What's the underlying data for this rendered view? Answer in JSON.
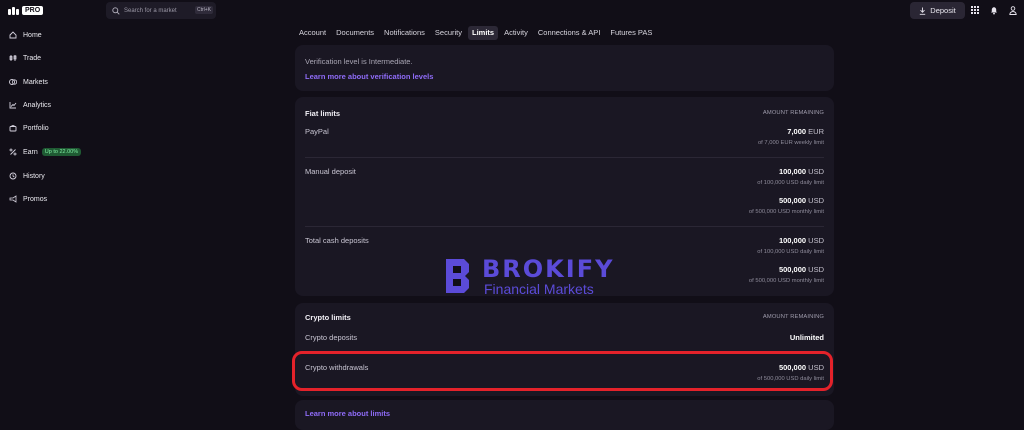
{
  "app": {
    "pro_badge": "PRO"
  },
  "search": {
    "placeholder": "Search for a market",
    "shortcut": "Ctrl+K"
  },
  "header": {
    "deposit_label": "Deposit"
  },
  "sidebar": {
    "items": [
      {
        "label": "Home",
        "icon": "home-icon"
      },
      {
        "label": "Trade",
        "icon": "trade-icon"
      },
      {
        "label": "Markets",
        "icon": "markets-icon"
      },
      {
        "label": "Analytics",
        "icon": "analytics-icon"
      },
      {
        "label": "Portfolio",
        "icon": "portfolio-icon"
      },
      {
        "label": "Earn",
        "icon": "percent-icon",
        "badge": "Up to 22.00%"
      },
      {
        "label": "History",
        "icon": "history-icon"
      },
      {
        "label": "Promos",
        "icon": "promos-icon"
      }
    ]
  },
  "tabs": [
    {
      "label": "Account"
    },
    {
      "label": "Documents"
    },
    {
      "label": "Notifications"
    },
    {
      "label": "Security"
    },
    {
      "label": "Limits",
      "active": true
    },
    {
      "label": "Activity"
    },
    {
      "label": "Connections & API"
    },
    {
      "label": "Futures PAS"
    }
  ],
  "verification": {
    "text": "Verification level is Intermediate.",
    "link": "Learn more about verification levels"
  },
  "fiat": {
    "title": "Fiat limits",
    "column_header": "AMOUNT REMAINING",
    "paypal": {
      "label": "PayPal",
      "amount": "7,000",
      "unit": "EUR",
      "limit": "of 7,000 EUR weekly limit"
    },
    "manual_deposit": {
      "label": "Manual deposit",
      "daily": {
        "amount": "100,000",
        "unit": "USD",
        "limit": "of 100,000 USD daily limit"
      },
      "monthly": {
        "amount": "500,000",
        "unit": "USD",
        "limit": "of 500,000 USD monthly limit"
      }
    },
    "total_cash": {
      "label": "Total cash deposits",
      "daily": {
        "amount": "100,000",
        "unit": "USD",
        "limit": "of 100,000 USD daily limit"
      },
      "monthly": {
        "amount": "500,000",
        "unit": "USD",
        "limit": "of 500,000 USD monthly limit"
      }
    }
  },
  "crypto": {
    "title": "Crypto limits",
    "column_header": "AMOUNT REMAINING",
    "deposits": {
      "label": "Crypto deposits",
      "value": "Unlimited"
    },
    "withdrawals": {
      "label": "Crypto withdrawals",
      "amount": "500,000",
      "unit": "USD",
      "limit": "of 500,000 USD daily limit"
    }
  },
  "footer": {
    "link": "Learn more about limits"
  },
  "watermark": {
    "brand": "BROKIFY",
    "tagline": "Financial Markets"
  },
  "colors": {
    "accent": "#8f6cf8",
    "highlight": "#e4222a",
    "background": "#110e17",
    "card": "#1a1723"
  }
}
